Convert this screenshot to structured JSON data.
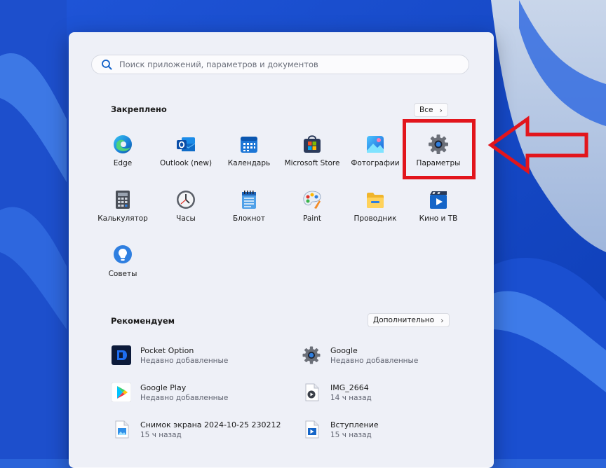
{
  "search": {
    "placeholder": "Поиск приложений, параметров и документов"
  },
  "pinned": {
    "title": "Закреплено",
    "all_button": "Все",
    "apps": [
      {
        "label": "Edge",
        "icon": "edge-icon"
      },
      {
        "label": "Outlook (new)",
        "icon": "outlook-icon"
      },
      {
        "label": "Календарь",
        "icon": "calendar-icon"
      },
      {
        "label": "Microsoft Store",
        "icon": "store-icon"
      },
      {
        "label": "Фотографии",
        "icon": "photos-icon"
      },
      {
        "label": "Параметры",
        "icon": "gear-icon"
      },
      {
        "label": "Калькулятор",
        "icon": "calculator-icon"
      },
      {
        "label": "Часы",
        "icon": "clock-icon"
      },
      {
        "label": "Блокнот",
        "icon": "notepad-icon"
      },
      {
        "label": "Paint",
        "icon": "paint-icon"
      },
      {
        "label": "Проводник",
        "icon": "folder-icon"
      },
      {
        "label": "Кино и ТВ",
        "icon": "movies-icon"
      },
      {
        "label": "Советы",
        "icon": "tips-icon"
      }
    ]
  },
  "recommended": {
    "title": "Рекомендуем",
    "more_button": "Дополнительно",
    "items": [
      {
        "name": "Pocket Option",
        "sub": "Недавно добавленные",
        "icon": "pocket-option-icon"
      },
      {
        "name": "Google",
        "sub": "Недавно добавленные",
        "icon": "google-settings-icon"
      },
      {
        "name": "Google Play",
        "sub": "Недавно добавленные",
        "icon": "google-play-icon"
      },
      {
        "name": "IMG_2664",
        "sub": "14 ч назад",
        "icon": "video-file-icon"
      },
      {
        "name": "Снимок экрана 2024-10-25 230212",
        "sub": "15 ч назад",
        "icon": "image-file-icon"
      },
      {
        "name": "Вступление",
        "sub": "15 ч назад",
        "icon": "video-file-icon"
      }
    ]
  },
  "colors": {
    "accent": "#e2151c",
    "wallpaper": "#2a63d9",
    "menu_bg": "#eef0f7"
  }
}
